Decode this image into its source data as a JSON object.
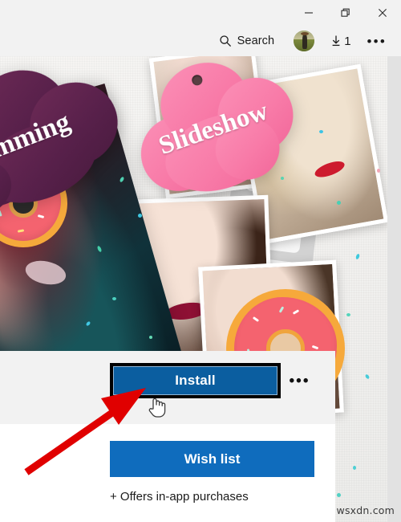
{
  "window": {
    "controls": [
      {
        "name": "minimize",
        "glyph": "minimize-icon"
      },
      {
        "name": "restore",
        "glyph": "restore-icon"
      },
      {
        "name": "close",
        "glyph": "close-icon"
      }
    ]
  },
  "header": {
    "search_label": "Search",
    "search_icon": "search-icon",
    "avatar_icon": "user-avatar",
    "downloads_icon": "download-arrow-icon",
    "downloads_count": "1",
    "overflow_icon": "ellipsis-icon",
    "overflow_label": "•••"
  },
  "hero": {
    "badges": [
      {
        "id": "slimming",
        "label": "imming",
        "color": "#57204a"
      },
      {
        "id": "slideshow",
        "label": "Slideshow",
        "color": "#f87ba8"
      }
    ],
    "decorations": [
      {
        "id": "donut-left",
        "name": "donut-sticker"
      },
      {
        "id": "donut-right",
        "name": "donut-sticker"
      },
      {
        "id": "film-strip",
        "name": "film-strip"
      }
    ]
  },
  "actions": {
    "install_label": "Install",
    "install_color": "#0b5ea0",
    "more_label": "•••",
    "wishlist_label": "Wish list",
    "wishlist_color": "#0f6cbd",
    "in_app_note": "+ Offers in-app purchases"
  },
  "annotation": {
    "arrow_color": "#e00000"
  },
  "watermark": {
    "text": "wsxdn.com"
  }
}
